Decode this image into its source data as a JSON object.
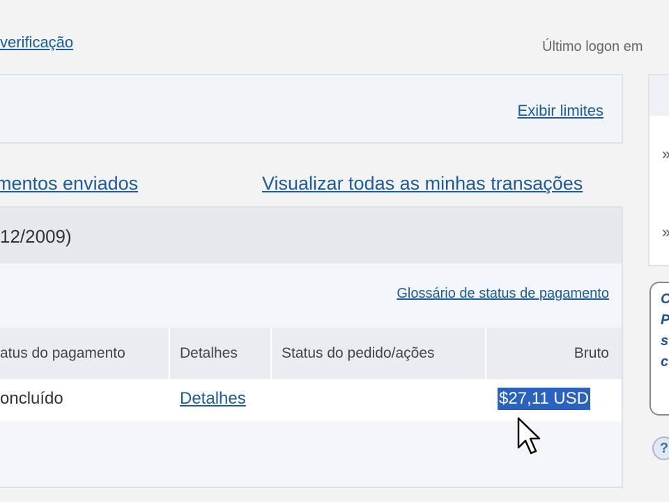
{
  "header": {
    "verification_link": "verificação",
    "last_logon": "Último logon em"
  },
  "limits": {
    "view_limits_link": "Exibir limites"
  },
  "side_panel": {
    "bullet_1": "»",
    "bullet_2": "»",
    "promo_text": "C\nP\ns\nc",
    "help_icon": "?"
  },
  "nav": {
    "payments_sent": "mentos enviados",
    "all_transactions": "Visualizar todas as minhas transações"
  },
  "transaction": {
    "date_range": "12/2009)",
    "glossary_link": "Glossário de status de pagamento",
    "columns": {
      "status": "atus do pagamento",
      "details": "Detalhes",
      "order_status": "Status do pedido/ações",
      "gross": "Bruto"
    },
    "row": {
      "status": "oncluído",
      "details_link": "Detalhes",
      "order_status": "",
      "gross": "$27,11 USD"
    }
  },
  "colors": {
    "link": "#1a5ca0",
    "selection": "#2a62c4",
    "panel_bg": "#f2f6fa",
    "header_bg": "#e5e9ee"
  }
}
